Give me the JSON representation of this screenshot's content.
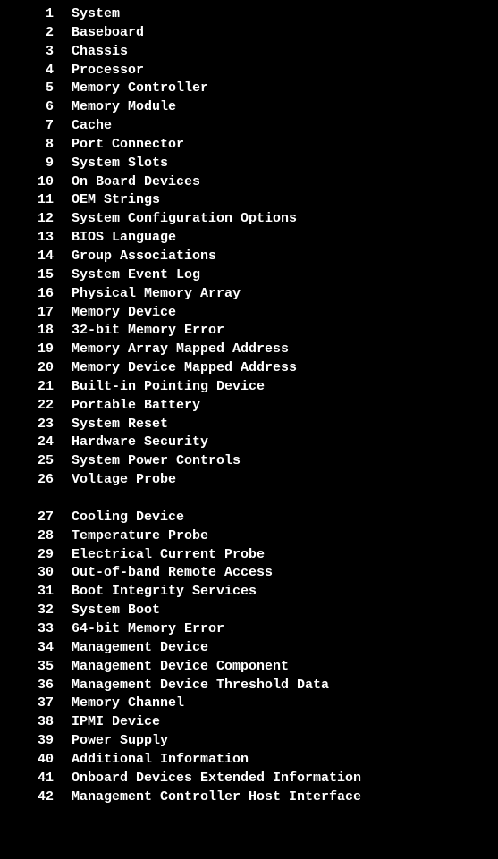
{
  "lines": [
    {
      "num": "1",
      "text": "System"
    },
    {
      "num": "2",
      "text": "Baseboard"
    },
    {
      "num": "3",
      "text": "Chassis"
    },
    {
      "num": "4",
      "text": "Processor"
    },
    {
      "num": "5",
      "text": "Memory Controller"
    },
    {
      "num": "6",
      "text": "Memory Module"
    },
    {
      "num": "7",
      "text": "Cache"
    },
    {
      "num": "8",
      "text": "Port Connector"
    },
    {
      "num": "9",
      "text": "System Slots"
    },
    {
      "num": "10",
      "text": "On Board Devices"
    },
    {
      "num": "11",
      "text": "OEM Strings"
    },
    {
      "num": "12",
      "text": "System Configuration Options"
    },
    {
      "num": "13",
      "text": "BIOS Language"
    },
    {
      "num": "14",
      "text": "Group Associations"
    },
    {
      "num": "15",
      "text": "System Event Log"
    },
    {
      "num": "16",
      "text": "Physical Memory Array"
    },
    {
      "num": "17",
      "text": "Memory Device"
    },
    {
      "num": "18",
      "text": "32-bit Memory Error"
    },
    {
      "num": "19",
      "text": "Memory Array Mapped Address"
    },
    {
      "num": "20",
      "text": "Memory Device Mapped Address"
    },
    {
      "num": "21",
      "text": "Built-in Pointing Device"
    },
    {
      "num": "22",
      "text": "Portable Battery"
    },
    {
      "num": "23",
      "text": "System Reset"
    },
    {
      "num": "24",
      "text": "Hardware Security"
    },
    {
      "num": "25",
      "text": "System Power Controls"
    },
    {
      "num": "26",
      "text": "Voltage Probe"
    },
    {
      "blank": true
    },
    {
      "num": "27",
      "text": "Cooling Device"
    },
    {
      "num": "28",
      "text": "Temperature Probe"
    },
    {
      "num": "29",
      "text": "Electrical Current Probe"
    },
    {
      "num": "30",
      "text": "Out-of-band Remote Access"
    },
    {
      "num": "31",
      "text": "Boot Integrity Services"
    },
    {
      "num": "32",
      "text": "System Boot"
    },
    {
      "num": "33",
      "text": "64-bit Memory Error"
    },
    {
      "num": "34",
      "text": "Management Device"
    },
    {
      "num": "35",
      "text": "Management Device Component"
    },
    {
      "num": "36",
      "text": "Management Device Threshold Data"
    },
    {
      "num": "37",
      "text": "Memory Channel"
    },
    {
      "num": "38",
      "text": "IPMI Device"
    },
    {
      "num": "39",
      "text": "Power Supply"
    },
    {
      "num": "40",
      "text": "Additional Information"
    },
    {
      "num": "41",
      "text": "Onboard Devices Extended Information"
    },
    {
      "num": "42",
      "text": "Management Controller Host Interface"
    }
  ]
}
